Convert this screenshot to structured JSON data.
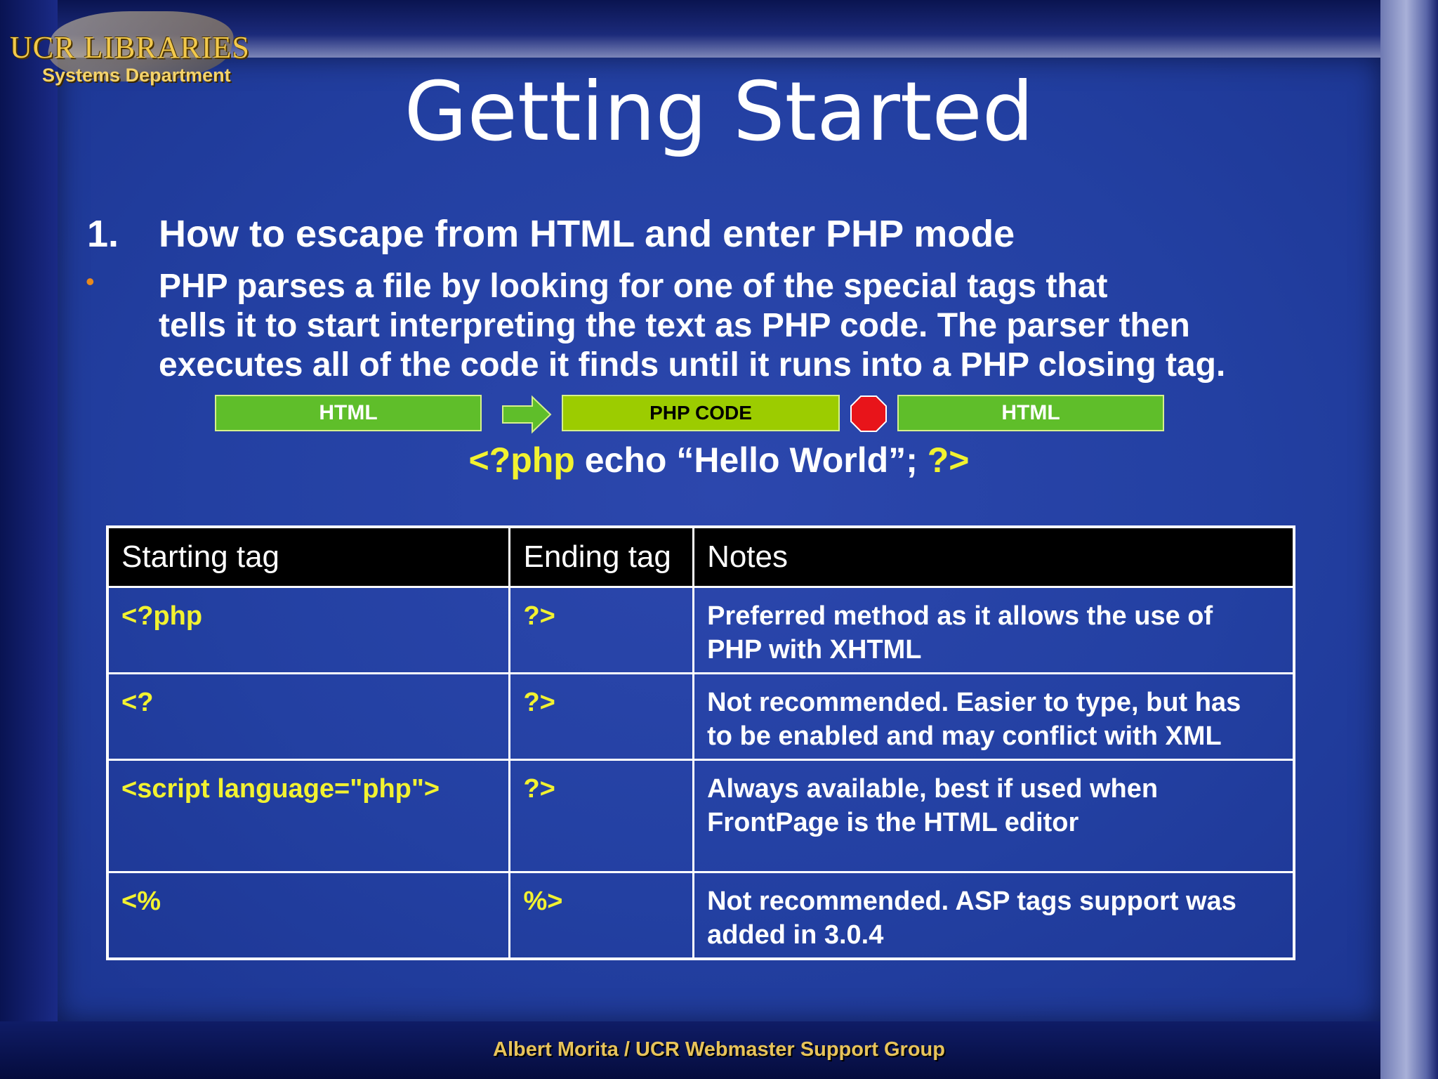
{
  "logo": {
    "line1": "UCR LIBRARIES",
    "line2": "Systems Department"
  },
  "title": "Getting Started",
  "heading": {
    "number": "1.",
    "text": "How to escape from HTML and enter PHP mode"
  },
  "bullet": {
    "symbol": "•",
    "lines": [
      "PHP parses a file by looking for one of the special tags that",
      "tells it to start interpreting the text as PHP code. The parser then",
      "executes all of the code it finds until it runs into a PHP closing tag."
    ]
  },
  "flow": {
    "box1": "HTML",
    "box2": "PHP CODE",
    "box3": "HTML"
  },
  "code": {
    "open": "<?php",
    "body": " echo “Hello World”; ",
    "close": "?>"
  },
  "table": {
    "headers": [
      "Starting tag",
      "Ending tag",
      "Notes"
    ],
    "rows": [
      {
        "start": "<?php",
        "end": "?>",
        "note_lines": [
          "Preferred method as it allows the use of",
          "PHP with XHTML"
        ]
      },
      {
        "start": "<?",
        "end": "?>",
        "note_lines": [
          "Not recommended. Easier to type, but has",
          "to be enabled and may conflict with XML"
        ]
      },
      {
        "start": "<script language=\"php\">",
        "end": "?>",
        "note_lines": [
          "Always available, best if used when",
          "FrontPage is the HTML editor"
        ]
      },
      {
        "start": "<%",
        "end": "%>",
        "note_lines": [
          "Not recommended. ASP tags support was",
          "added in 3.0.4"
        ]
      }
    ]
  },
  "footer": "Albert Morita / UCR Webmaster Support Group",
  "colors": {
    "background": "#2340a2",
    "accent_yellow": "#f2f230",
    "box_green": "#5fbe2a",
    "php_box": "#9ccc00",
    "stop_red": "#e8141a",
    "bullet_orange": "#e8891c"
  }
}
